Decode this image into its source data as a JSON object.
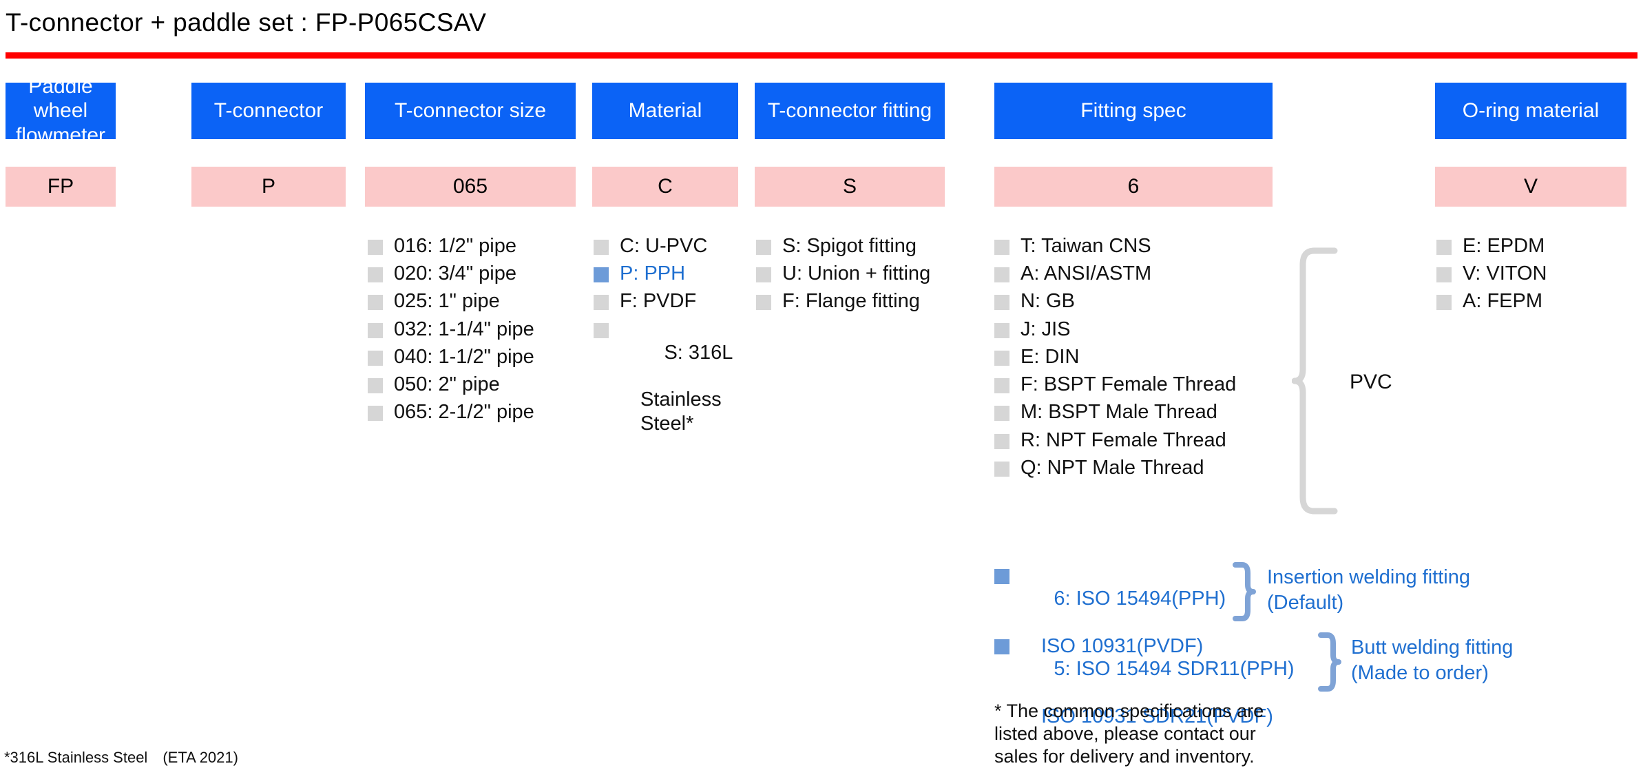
{
  "title": "T-connector + paddle set : FP-P065CSAV",
  "accent_colors": {
    "rule": "#ff0000",
    "header_blue": "#0B63F6",
    "value_pink": "#FBC9C9",
    "checkbox_gray": "#d6d6d6",
    "checkbox_selected": "#6D9BD8",
    "selected_text": "#1F6FD0",
    "brace_gray": "#d6d6d6",
    "brace_blue": "#7FA3D6"
  },
  "columns": [
    {
      "id": "paddle-wheel-flowmeter",
      "header": "Paddle wheel flowmeter",
      "value": "FP",
      "options": []
    },
    {
      "id": "t-connector",
      "header": "T-connector",
      "value": "P",
      "options": []
    },
    {
      "id": "t-connector-size",
      "header": "T-connector size",
      "value": "065",
      "options": [
        {
          "label": "016: 1/2\" pipe",
          "selected": false
        },
        {
          "label": "020: 3/4\" pipe",
          "selected": false
        },
        {
          "label": "025: 1\" pipe",
          "selected": false
        },
        {
          "label": "032: 1-1/4\" pipe",
          "selected": false
        },
        {
          "label": "040: 1-1/2\" pipe",
          "selected": false
        },
        {
          "label": "050: 2\" pipe",
          "selected": false
        },
        {
          "label": "065: 2-1/2\" pipe",
          "selected": false
        }
      ]
    },
    {
      "id": "material",
      "header": "Material",
      "value": "C",
      "options": [
        {
          "label": "C: U-PVC",
          "selected": false
        },
        {
          "label": "P: PPH",
          "selected": true
        },
        {
          "label": "F: PVDF",
          "selected": false
        },
        {
          "label": "S: 316L",
          "cont": "Stainless\nSteel*",
          "selected": false
        }
      ]
    },
    {
      "id": "t-connector-fitting",
      "header": "T-connector fitting",
      "value": "S",
      "options": [
        {
          "label": "S: Spigot fitting",
          "selected": false
        },
        {
          "label": "U: Union + fitting",
          "selected": false
        },
        {
          "label": "F: Flange fitting",
          "selected": false
        }
      ]
    },
    {
      "id": "fitting-spec",
      "header": "Fitting spec",
      "value": "6",
      "options": [
        {
          "label": "T: Taiwan CNS",
          "selected": false
        },
        {
          "label": "A: ANSI/ASTM",
          "selected": false
        },
        {
          "label": "N: GB",
          "selected": false
        },
        {
          "label": "J: JIS",
          "selected": false
        },
        {
          "label": "E: DIN",
          "selected": false
        },
        {
          "label": "F: BSPT Female Thread",
          "selected": false
        },
        {
          "label": "M: BSPT Male Thread",
          "selected": false
        },
        {
          "label": "R: NPT Female Thread",
          "selected": false
        },
        {
          "label": "Q: NPT Male Thread",
          "selected": false
        }
      ]
    },
    {
      "id": "o-ring-material",
      "header": "O-ring material",
      "value": "V",
      "options": [
        {
          "label": "E: EPDM",
          "selected": false
        },
        {
          "label": "V: VITON",
          "selected": false
        },
        {
          "label": "A: FEPM",
          "selected": false
        }
      ]
    }
  ],
  "pvc_brace_label": "PVC",
  "iso_options": [
    {
      "id": "iso-6",
      "code_line1": "6: ISO 15494(PPH)",
      "code_line2": "ISO 10931(PVDF)",
      "desc_line1": "Insertion welding fitting",
      "desc_line2": "(Default)",
      "selected": true
    },
    {
      "id": "iso-5",
      "code_line1": "5: ISO 15494 SDR11(PPH)",
      "code_line2": "ISO 10931 SDR21(PVDF)",
      "desc_line1": "Butt welding fitting",
      "desc_line2": "(Made to order)",
      "selected": true
    }
  ],
  "notes": {
    "spec_note": "* The common specifications are\nlisted above, please contact our\nsales for delivery and inventory.",
    "bottom_note": "*316L Stainless Steel　(ETA 2021)"
  }
}
